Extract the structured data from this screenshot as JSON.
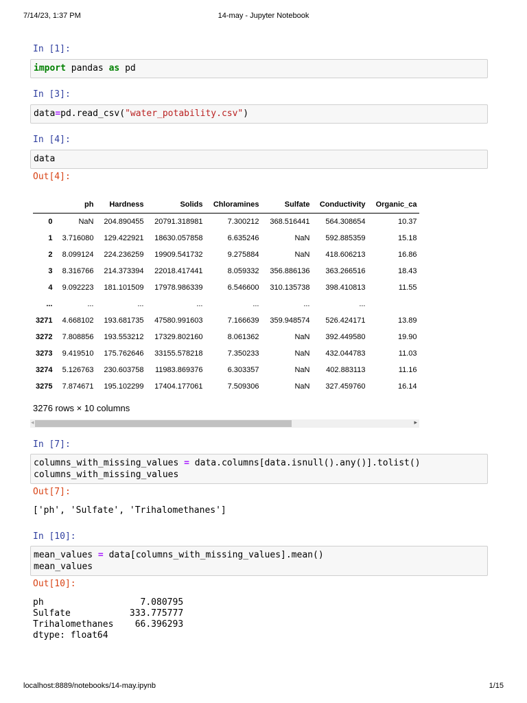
{
  "header": {
    "datetime": "7/14/23, 1:37 PM",
    "title": "14-may - Jupyter Notebook"
  },
  "footer": {
    "url": "localhost:8889/notebooks/14-may.ipynb",
    "page": "1/15"
  },
  "cells": [
    {
      "prompt": "In [1]:",
      "code": [
        {
          "t": "import",
          "c": "kw"
        },
        {
          "t": " pandas "
        },
        {
          "t": "as",
          "c": "kw"
        },
        {
          "t": " pd"
        }
      ]
    },
    {
      "prompt": "In [3]:",
      "code": [
        {
          "t": "data"
        },
        {
          "t": "=",
          "c": "op"
        },
        {
          "t": "pd.read_csv("
        },
        {
          "t": "\"water_potability.csv\"",
          "c": "str"
        },
        {
          "t": ")"
        }
      ]
    },
    {
      "prompt": "In [4]:",
      "code": [
        {
          "t": "data"
        }
      ],
      "out_prompt": "Out[4]:"
    },
    {
      "prompt": "In [7]:",
      "code": [
        {
          "t": "columns_with_missing_values "
        },
        {
          "t": "=",
          "c": "op"
        },
        {
          "t": " data.columns[data.isnull().any()].tolist()\ncolumns_with_missing_values"
        }
      ],
      "out_prompt": "Out[7]:",
      "output": "['ph', 'Sulfate', 'Trihalomethanes']"
    },
    {
      "prompt": "In [10]:",
      "code": [
        {
          "t": "mean_values "
        },
        {
          "t": "=",
          "c": "op"
        },
        {
          "t": " data[columns_with_missing_values].mean()\nmean_values"
        }
      ],
      "out_prompt": "Out[10]:",
      "output": "ph                  7.080795\nSulfate           333.775777\nTrihalomethanes    66.396293\ndtype: float64"
    }
  ],
  "dataframe": {
    "columns": [
      "",
      "ph",
      "Hardness",
      "Solids",
      "Chloramines",
      "Sulfate",
      "Conductivity",
      "Organic_ca"
    ],
    "rows": [
      [
        "0",
        "NaN",
        "204.890455",
        "20791.318981",
        "7.300212",
        "368.516441",
        "564.308654",
        "10.37"
      ],
      [
        "1",
        "3.716080",
        "129.422921",
        "18630.057858",
        "6.635246",
        "NaN",
        "592.885359",
        "15.18"
      ],
      [
        "2",
        "8.099124",
        "224.236259",
        "19909.541732",
        "9.275884",
        "NaN",
        "418.606213",
        "16.86"
      ],
      [
        "3",
        "8.316766",
        "214.373394",
        "22018.417441",
        "8.059332",
        "356.886136",
        "363.266516",
        "18.43"
      ],
      [
        "4",
        "9.092223",
        "181.101509",
        "17978.986339",
        "6.546600",
        "310.135738",
        "398.410813",
        "11.55"
      ],
      [
        "...",
        "...",
        "...",
        "...",
        "...",
        "...",
        "...",
        ""
      ],
      [
        "3271",
        "4.668102",
        "193.681735",
        "47580.991603",
        "7.166639",
        "359.948574",
        "526.424171",
        "13.89"
      ],
      [
        "3272",
        "7.808856",
        "193.553212",
        "17329.802160",
        "8.061362",
        "NaN",
        "392.449580",
        "19.90"
      ],
      [
        "3273",
        "9.419510",
        "175.762646",
        "33155.578218",
        "7.350233",
        "NaN",
        "432.044783",
        "11.03"
      ],
      [
        "3274",
        "5.126763",
        "230.603758",
        "11983.869376",
        "6.303357",
        "NaN",
        "402.883113",
        "11.16"
      ],
      [
        "3275",
        "7.874671",
        "195.102299",
        "17404.177061",
        "7.509306",
        "NaN",
        "327.459760",
        "16.14"
      ]
    ],
    "shape": "3276 rows × 10 columns",
    "scroll_fraction": 0.66
  }
}
